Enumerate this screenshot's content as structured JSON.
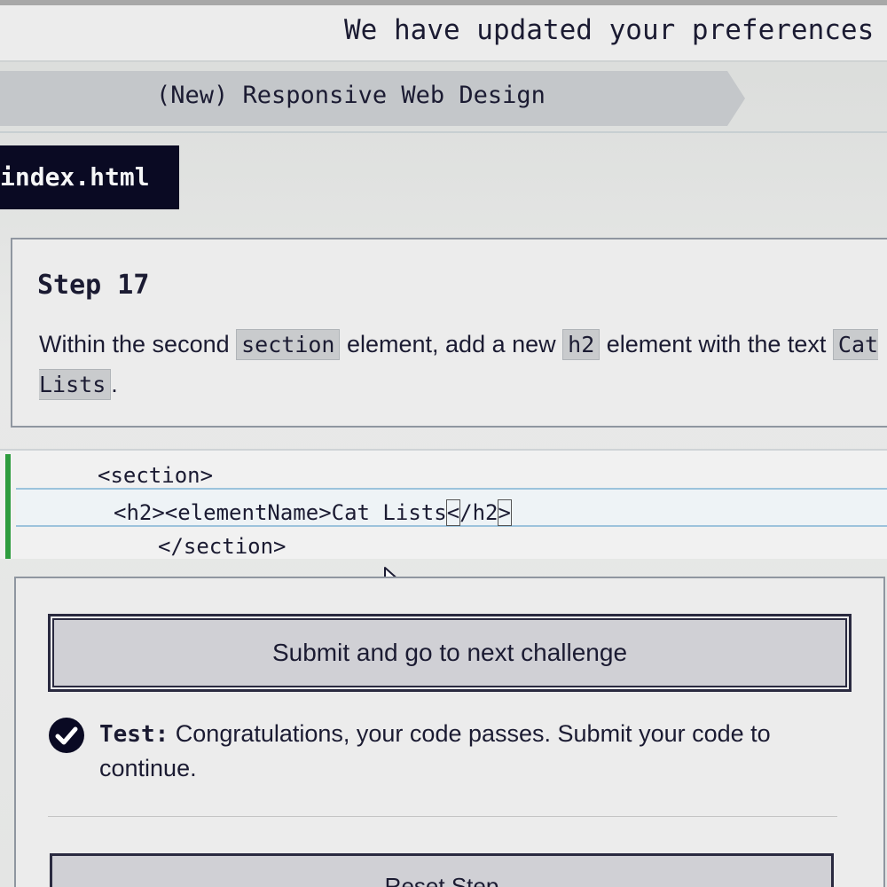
{
  "banner": {
    "message": "We have updated your preferences"
  },
  "breadcrumb": {
    "course": "(New) Responsive Web Design"
  },
  "editor_tab": {
    "file_name": "index.html"
  },
  "instructions": {
    "step_title": "Step 17",
    "text_1": "Within the second ",
    "chip_1": "section",
    "text_2": " element, add a new ",
    "chip_2": "h2",
    "text_3": " element with the text ",
    "chip_3": "Cat Lists",
    "text_4": "."
  },
  "code": {
    "line1": "<section>",
    "line2_text": "<h2><elementName>Cat Lists",
    "line2_bracket_open": "<",
    "line2_mid": "/h2",
    "line2_bracket_close": ">",
    "line3": "</section>"
  },
  "actions": {
    "submit_label": "Submit and go to next challenge",
    "reset_label": "Reset Step"
  },
  "test": {
    "label": "Test:",
    "message": " Congratulations, your code passes. Submit your code to continue."
  },
  "colors": {
    "nav_dark": "#0a0a23",
    "pass_green": "#2e9c3e"
  }
}
